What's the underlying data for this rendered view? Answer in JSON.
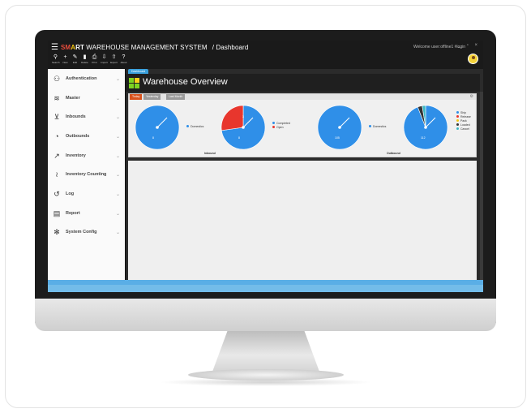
{
  "app": {
    "title_part1": "SM",
    "title_part2": "A",
    "title_part3": "RT",
    "title_rest": " WAREHOUSE MANAGEMENT SYSTEM",
    "breadcrumb": "/ Dashboard",
    "welcome": "Welcome user:offline1 #login",
    "window_controls": "_ ▫ ×"
  },
  "toolbar": [
    {
      "label": "Search",
      "icon": "search-icon",
      "glyph": "⚲"
    },
    {
      "label": "New",
      "icon": "plus-icon",
      "glyph": "+"
    },
    {
      "label": "Edit",
      "icon": "pencil-icon",
      "glyph": "✎"
    },
    {
      "label": "Delete",
      "icon": "trash-icon",
      "glyph": "▮"
    },
    {
      "label": "Print",
      "icon": "printer-icon",
      "glyph": "⎙"
    },
    {
      "label": "Import",
      "icon": "import-icon",
      "glyph": "⇩"
    },
    {
      "label": "Export",
      "icon": "export-icon",
      "glyph": "⇧"
    },
    {
      "label": "About",
      "icon": "help-icon",
      "glyph": "?"
    }
  ],
  "sidebar": {
    "items": [
      {
        "label": "Authentication",
        "icon": "users-icon",
        "glyph": "⚇"
      },
      {
        "label": "Master",
        "icon": "layers-icon",
        "glyph": "≋"
      },
      {
        "label": "Inbounds",
        "icon": "cart-icon",
        "glyph": "⊻"
      },
      {
        "label": "Outbounds",
        "icon": "outbound-icon",
        "glyph": "◔"
      },
      {
        "label": "Inventory",
        "icon": "trend-icon",
        "glyph": "↗"
      },
      {
        "label": "Inventory Counting",
        "icon": "rfid-icon",
        "glyph": "≀"
      },
      {
        "label": "Log",
        "icon": "history-icon",
        "glyph": "↺"
      },
      {
        "label": "Report",
        "icon": "report-icon",
        "glyph": "▤"
      },
      {
        "label": "System Config",
        "icon": "gear-icon",
        "glyph": "✻"
      }
    ]
  },
  "main": {
    "tab": "Dashboard",
    "heading": "Warehouse Overview",
    "panel_tabs": [
      "Today",
      "Yesterday",
      "Last Month"
    ]
  },
  "chart_data": [
    {
      "type": "pie",
      "series": [
        {
          "name": "Domestics",
          "values": [
            8
          ]
        }
      ],
      "legend": [
        "Domestics"
      ],
      "data_labels": [
        "8"
      ]
    },
    {
      "type": "pie",
      "title": "Inbound",
      "categories": [
        "Completed",
        "Open"
      ],
      "values": [
        8,
        3
      ],
      "legend": [
        "Completed",
        "Open"
      ],
      "data_labels": [
        "8",
        "3"
      ]
    },
    {
      "type": "pie",
      "series": [
        {
          "name": "Domestics",
          "values": [
            105
          ]
        }
      ],
      "legend": [
        "Domestics"
      ],
      "data_labels": [
        "105"
      ]
    },
    {
      "type": "pie",
      "title": "Outbound",
      "categories": [
        "Ship",
        "Release",
        "Pack",
        "Loaded",
        "Cancel"
      ],
      "values": [
        112,
        0,
        0,
        4,
        3
      ],
      "legend": [
        "Ship",
        "Release",
        "Pack",
        "Loaded",
        "Cancel"
      ],
      "data_labels": [
        "112"
      ]
    }
  ],
  "colors": {
    "blue": "#2f8fe8",
    "red": "#e8362d",
    "yellow": "#f2c80f",
    "dark": "#333333",
    "teal": "#3bb8c4",
    "orange_tab": "#d9531e",
    "logo_green": "#7ed321",
    "logo_yellow": "#f8d11b"
  }
}
